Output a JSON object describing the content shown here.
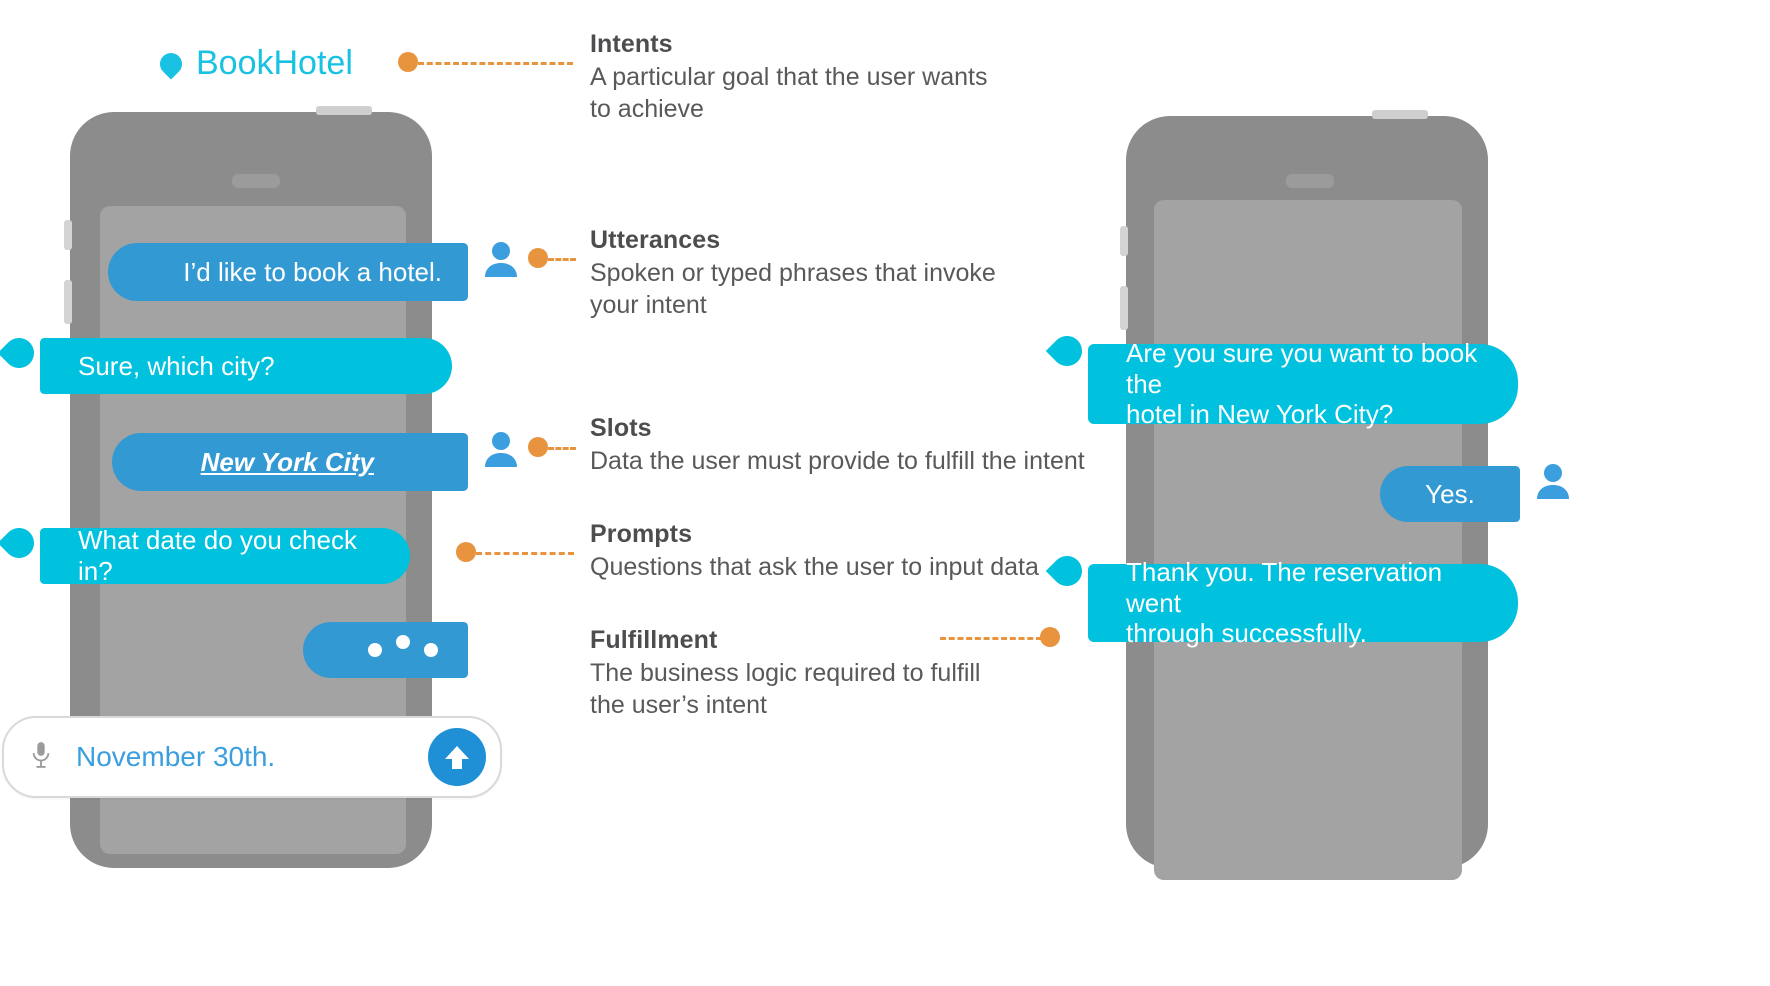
{
  "brand": {
    "label": "BookHotel",
    "icon": "speech-bubble-icon"
  },
  "colors": {
    "user_bubble": "#3399d3",
    "bot_bubble": "#00c1de",
    "accent_orange": "#e8943e",
    "brand_cyan": "#19c1e3",
    "text_gray": "#58595b",
    "phone_body": "#8c8c8c",
    "phone_screen": "#a3a3a3"
  },
  "annotations": [
    {
      "title": "Intents",
      "desc": "A particular goal that the user wants\nto achieve"
    },
    {
      "title": "Utterances",
      "desc": "Spoken or typed phrases that invoke\nyour intent"
    },
    {
      "title": "Slots",
      "desc": "Data the user must provide to fulfill the intent"
    },
    {
      "title": "Prompts",
      "desc": "Questions that ask the user to input data"
    },
    {
      "title": "Fulfillment",
      "desc": "The business logic required to fulfill\nthe user’s intent"
    }
  ],
  "left_phone": {
    "messages": [
      {
        "sender": "user",
        "text": "I’d like to book a hotel."
      },
      {
        "sender": "bot",
        "text": "Sure, which city?"
      },
      {
        "sender": "user",
        "text": "New York City",
        "style": "slot"
      },
      {
        "sender": "bot",
        "text": "What date do you check in?"
      },
      {
        "sender": "user",
        "text": "",
        "style": "typing"
      }
    ],
    "input": {
      "value": "November 30th.",
      "mic_icon": "microphone-icon",
      "send_icon": "send-arrow-up-icon"
    }
  },
  "right_phone": {
    "messages": [
      {
        "sender": "bot",
        "text": "Are you sure you want to book the\nhotel in New York City?"
      },
      {
        "sender": "user",
        "text": "Yes."
      },
      {
        "sender": "bot",
        "text": "Thank you. The reservation went\nthrough successfully."
      }
    ]
  }
}
